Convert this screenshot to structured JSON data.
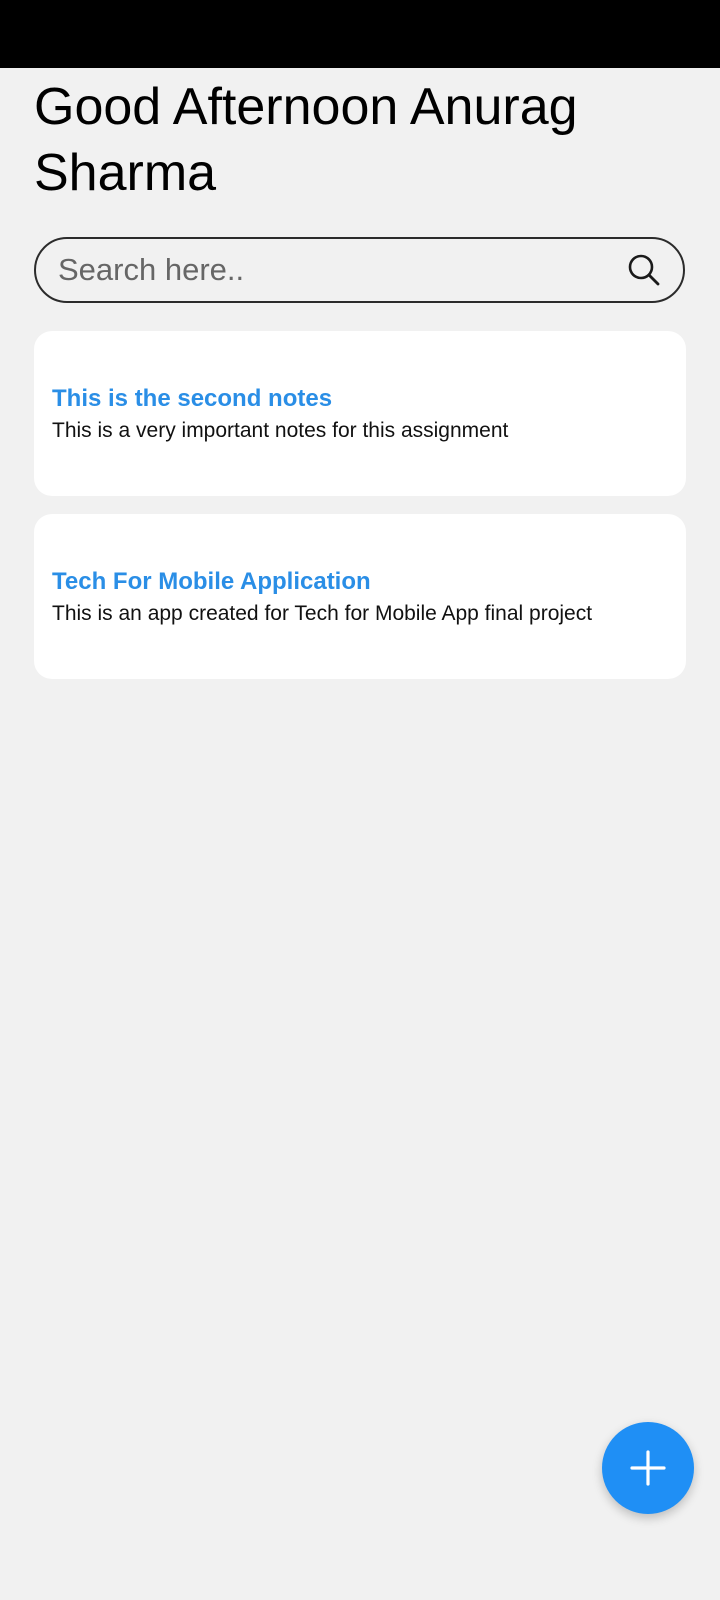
{
  "header": {
    "greeting": "Good Afternoon Anurag Sharma"
  },
  "search": {
    "placeholder": "Search here..",
    "value": "",
    "icon": "search-icon"
  },
  "notes": [
    {
      "title": "This is the second notes",
      "description": "This is a very important notes for this assignment"
    },
    {
      "title": "Tech For Mobile Application",
      "description": "This is an app created for Tech for Mobile App final project"
    }
  ],
  "fab": {
    "icon": "plus-icon"
  },
  "colors": {
    "background": "#f1f1f1",
    "status_bar": "#000000",
    "note_title": "#2a8ee6",
    "fab": "#1f8ff5",
    "card": "#ffffff"
  }
}
